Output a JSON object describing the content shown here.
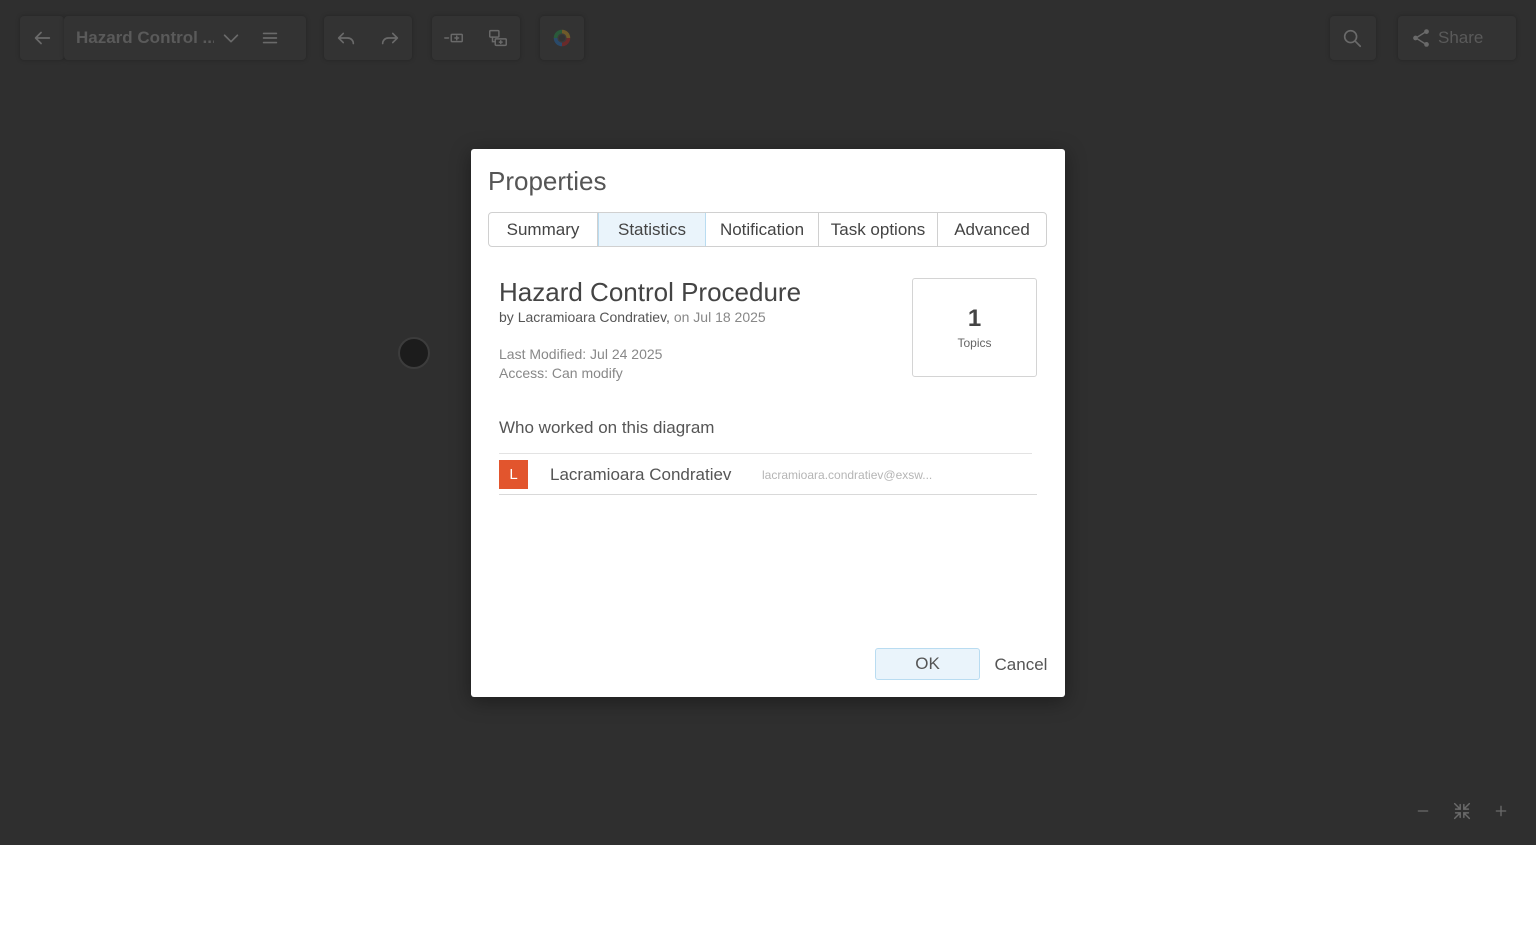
{
  "toolbar": {
    "document_title": "Hazard Control ...",
    "share_label": "Share",
    "icons": [
      "back-arrow-icon",
      "chevron-down-icon",
      "menu-icon",
      "undo-icon",
      "redo-icon",
      "insert-topic-icon",
      "insert-subtopic-icon",
      "theme-palette-icon",
      "search-icon",
      "share-icon"
    ]
  },
  "zoom": {
    "icons": [
      "zoom-out-icon",
      "fit-to-screen-icon",
      "zoom-in-icon"
    ]
  },
  "dialog": {
    "title": "Properties",
    "tabs": [
      {
        "label": "Summary",
        "active": false
      },
      {
        "label": "Statistics",
        "active": true
      },
      {
        "label": "Notification",
        "active": false
      },
      {
        "label": "Task options",
        "active": false
      },
      {
        "label": "Advanced",
        "active": false
      }
    ],
    "diagram_name": "Hazard Control Procedure",
    "by_prefix": "by ",
    "author": "Lacramioara Condratiev,",
    "created": " on Jul 18 2025",
    "last_modified": "Last Modified: Jul 24 2025",
    "access": "Access: Can modify",
    "stats": {
      "value": "1",
      "label": "Topics"
    },
    "who_heading": "Who worked on this diagram",
    "collaborators": [
      {
        "initial": "L",
        "name": "Lacramioara Condratiev",
        "email": "lacramioara.condratiev@exsw...",
        "avatar_color": "#e2552d"
      }
    ],
    "ok_label": "OK",
    "cancel_label": "Cancel"
  },
  "colors": {
    "app_background": "#2f2f2f",
    "accent_light": "#eaf4fb",
    "accent_border": "#b9dcf1"
  }
}
